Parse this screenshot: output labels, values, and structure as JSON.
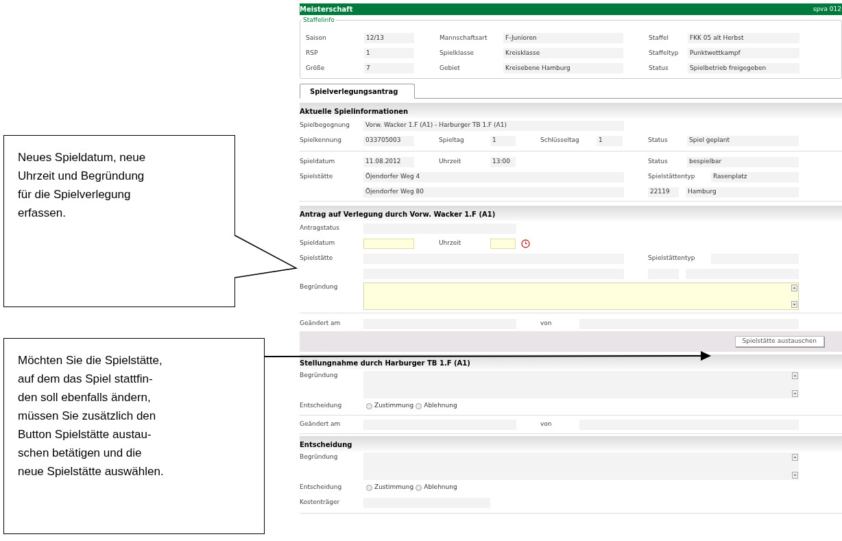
{
  "callouts": [
    {
      "text": "Neues Spieldatum, neue\nUhrzeit und Begründung\nfür die Spielverlegung\nerfassen."
    },
    {
      "text": "Möchten Sie die Spielstätte,\nauf dem das Spiel stattfin-\nden soll ebenfalls ändern,\nmüssen Sie zusätzlich den\nButton Spielstätte austau-\nschen betätigen und die\nneue Spielstätte auswählen."
    }
  ],
  "header": {
    "title": "Meisterschaft",
    "code": "spva 012"
  },
  "staffelinfo": {
    "legend": "Staffelinfo",
    "fields": [
      {
        "label": "Saison",
        "value": "12/13"
      },
      {
        "label": "Mannschaftsart",
        "value": "F-Junioren"
      },
      {
        "label": "Staffel",
        "value": "FKK 05 alt Herbst"
      },
      {
        "label": "RSP",
        "value": "1"
      },
      {
        "label": "Spielklasse",
        "value": "Kreisklasse"
      },
      {
        "label": "Staffeltyp",
        "value": "Punktwettkampf"
      },
      {
        "label": "Größe",
        "value": "7"
      },
      {
        "label": "Gebiet",
        "value": "Kreisebene Hamburg"
      },
      {
        "label": "Status",
        "value": "Spielbetrieb freigegeben"
      }
    ]
  },
  "tabs": [
    {
      "label": "Spielverlegungsantrag",
      "selected": true
    }
  ],
  "current": {
    "title": "Aktuelle Spielinformationen",
    "fields": [
      {
        "label": "Spielbegegnung",
        "value": "Vorw. Wacker 1.F (A1) - Harburger TB 1.F (A1)"
      },
      {
        "label": "Spielkennung",
        "value": "033705003"
      },
      {
        "label": "Spieltag",
        "value": "1"
      },
      {
        "label": "Schlüsseltag",
        "value": "1"
      },
      {
        "label": "Status",
        "value": "Spiel geplant"
      },
      {
        "label": "Spieldatum",
        "value": "11.08.2012"
      },
      {
        "label": "Uhrzeit",
        "value": "13:00"
      },
      {
        "label": "Status",
        "value": "bespielbar"
      },
      {
        "label": "Spielstätte",
        "value": "Öjendorfer Weg 4"
      },
      {
        "label": "Spielstättentyp",
        "value": "Rasenplatz"
      },
      {
        "value": "Öjendorfer Weg 80"
      },
      {
        "value": "22119"
      },
      {
        "value": "Hamburg"
      }
    ]
  },
  "application": {
    "title": "Antrag auf Verlegung durch Vorw. Wacker 1.F (A1)",
    "fields": [
      {
        "label": "Antragstatus",
        "editable": false
      },
      {
        "label": "Spieldatum",
        "editable": true
      },
      {
        "label": "Uhrzeit",
        "editable": true
      },
      {
        "label": "Spielstätte",
        "editable": false
      },
      {
        "label": "Spielstättentyp",
        "editable": false
      },
      {
        "editable": false
      },
      {
        "editable": false
      },
      {
        "editable": false
      },
      {
        "label": "Begründung",
        "editable": true
      },
      {
        "label": "Geändert am",
        "editable": false
      },
      {
        "label": "von",
        "editable": false
      }
    ],
    "button": "Spielstätte austauschen"
  },
  "statement": {
    "title": "Stellungnahme durch Harburger TB 1.F (A1)",
    "reason_label": "Begründung",
    "decision_label": "Entscheidung",
    "options": [
      {
        "label": "Zustimmung",
        "selected": false
      },
      {
        "label": "Ablehnung",
        "selected": false
      }
    ],
    "changed_label": "Geändert am",
    "by_label": "von"
  },
  "decision": {
    "title": "Entscheidung",
    "reason_label": "Begründung",
    "decision_label": "Entscheidung",
    "options": [
      {
        "label": "Zustimmung",
        "selected": false
      },
      {
        "label": "Ablehnung",
        "selected": false
      }
    ],
    "cost_label": "Kostenträger"
  }
}
